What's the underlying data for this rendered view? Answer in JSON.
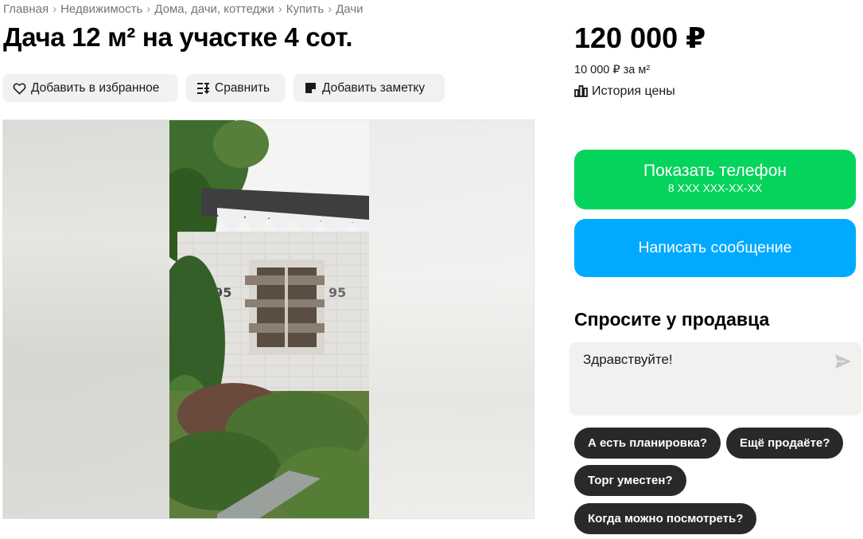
{
  "breadcrumbs": [
    "Главная",
    "Недвижимость",
    "Дома, дачи, коттеджи",
    "Купить",
    "Дачи"
  ],
  "title": "Дача 12 м² на участке 4 сот.",
  "actions": {
    "favorite": "Добавить в избранное",
    "compare": "Сравнить",
    "note": "Добавить заметку"
  },
  "price": {
    "value": "120 000 ₽",
    "per_unit": "10 000 ₽ за м²",
    "history": "История цены"
  },
  "contact": {
    "phone_label": "Показать телефон",
    "phone_masked": "8 XXX XXX-XX-XX",
    "message_label": "Написать сообщение"
  },
  "ask": {
    "title": "Спросите у продавца",
    "message": "Здравствуйте!",
    "suggestions": [
      "А есть планировка?",
      "Ещё продаёте?",
      "Торг уместен?",
      "Когда можно посмотреть?"
    ]
  },
  "colors": {
    "phone_button": "#04d45b",
    "message_button": "#00aaff",
    "chip": "#292929"
  },
  "icons": [
    "heart-icon",
    "compare-icon",
    "note-icon",
    "chart-icon",
    "send-icon"
  ]
}
